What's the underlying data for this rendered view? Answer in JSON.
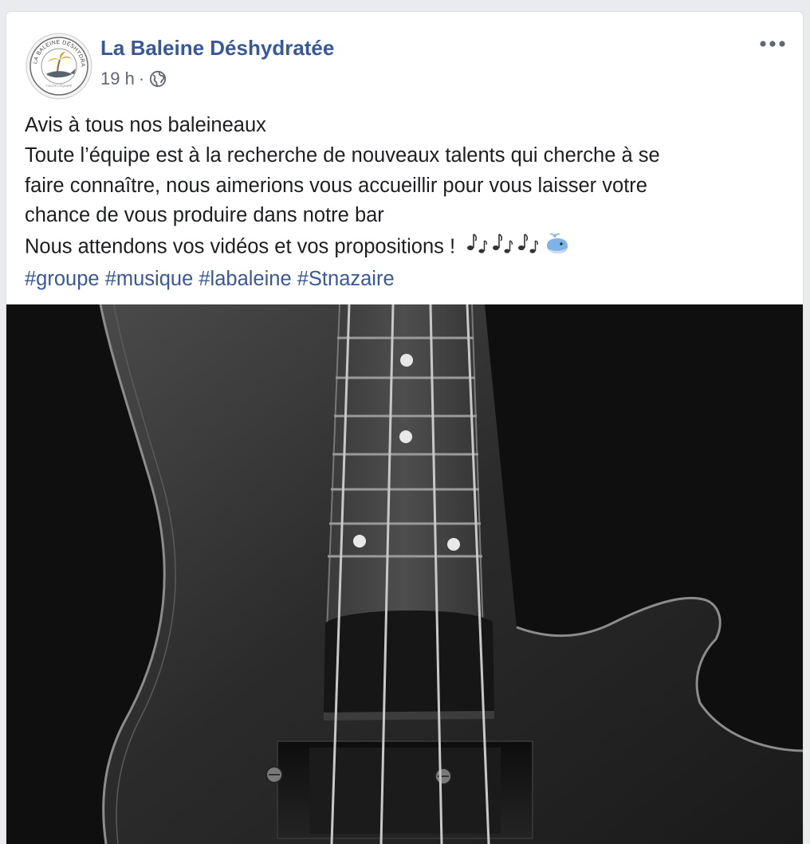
{
  "post": {
    "page_name": "La Baleine Déshydratée",
    "timestamp": "19 h",
    "separator": "·",
    "audience_icon": "globe-icon",
    "more_icon": "more-options-icon",
    "avatar_logo_text": "LA BALEINE DÉSHYDRATÉE",
    "text_lines": [
      "Avis à tous nos baleineaux",
      "Toute l’équipe est à la recherche de nouveaux talents qui cherche à se",
      "faire connaître, nous aimerions vous accueillir pour vous laisser votre",
      "chance de vous produire dans notre bar",
      "Nous attendons vos vidéos et vos propositions !"
    ],
    "emoji_trailing": "🎶🎶🎶🐳",
    "hashtags": [
      "#groupe",
      "#musique",
      "#labaleine",
      "#Stnazaire"
    ],
    "photo_subject": "bass-guitar-photo"
  },
  "colors": {
    "link": "#385898",
    "text": "#1c1e21",
    "meta": "#606770",
    "card_bg": "#ffffff",
    "page_bg": "#e9ebee"
  }
}
